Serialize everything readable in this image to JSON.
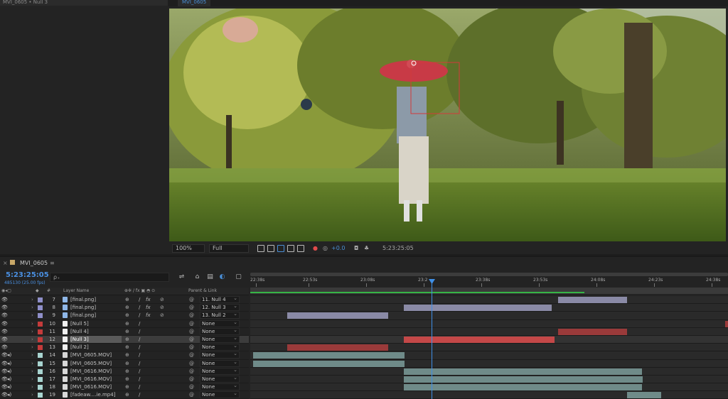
{
  "project_panel": {
    "title": "MVI_0605 • Null 3"
  },
  "viewer": {
    "tab": "MVI_0605",
    "zoom": "100%",
    "resolution": "Full",
    "exposure": "+0.0",
    "timecode": "5:23:25:05"
  },
  "timeline": {
    "comp_tab": "MVI_0605",
    "timecode": "5:23:25:05",
    "frame_info": "485130 (25.00 fps)",
    "search_placeholder": "ρ₊",
    "headers": {
      "layer_name": "Layer Name",
      "parent": "Parent & Link",
      "hash": "#"
    },
    "ruler": [
      "22:38s",
      "22:53s",
      "23:08s",
      "23:2",
      "23:38s",
      "23:53s",
      "24:08s",
      "24:23s",
      "24:38s"
    ],
    "layers": [
      {
        "num": "7",
        "name": "[final.png]",
        "label": "#8f8fc9",
        "kind": "img",
        "audio": false,
        "fx": true,
        "parent": "11. Null 4",
        "bar_color": "#8a8aa6"
      },
      {
        "num": "8",
        "name": "[final.png]",
        "label": "#8f8fc9",
        "kind": "img",
        "audio": false,
        "fx": true,
        "parent": "12. Null 3",
        "bar_color": "#8a8aa6"
      },
      {
        "num": "9",
        "name": "[final.png]",
        "label": "#8f8fc9",
        "kind": "img",
        "audio": false,
        "fx": true,
        "parent": "13. Null 2",
        "bar_color": "#8a8aa6"
      },
      {
        "num": "10",
        "name": "[Null 5]",
        "label": "#c43b3b",
        "kind": "null",
        "audio": false,
        "fx": false,
        "parent": "None",
        "bar_color": "#9a3a3a"
      },
      {
        "num": "11",
        "name": "[Null 4]",
        "label": "#c43b3b",
        "kind": "null",
        "audio": false,
        "fx": false,
        "parent": "None",
        "bar_color": "#9a3a3a"
      },
      {
        "num": "12",
        "name": "[Null 3]",
        "label": "#c43b3b",
        "kind": "null",
        "audio": false,
        "fx": false,
        "parent": "None",
        "bar_color": "#c44848",
        "selected": true
      },
      {
        "num": "13",
        "name": "[Null 2]",
        "label": "#c43b3b",
        "kind": "null",
        "audio": false,
        "fx": false,
        "parent": "None",
        "bar_color": "#9a3a3a"
      },
      {
        "num": "14",
        "name": "[MVI_0605.MOV]",
        "label": "#a8d4d0",
        "kind": "vid",
        "audio": true,
        "fx": false,
        "parent": "None",
        "bar_color": "#6f8b89"
      },
      {
        "num": "15",
        "name": "[MVI_0605.MOV]",
        "label": "#a8d4d0",
        "kind": "vid",
        "audio": true,
        "fx": false,
        "parent": "None",
        "bar_color": "#6f8b89"
      },
      {
        "num": "16",
        "name": "[MVI_0616.MOV]",
        "label": "#a8d4d0",
        "kind": "vid",
        "audio": true,
        "fx": false,
        "parent": "None",
        "bar_color": "#6f8b89"
      },
      {
        "num": "17",
        "name": "[MVI_0616.MOV]",
        "label": "#a8d4d0",
        "kind": "vid",
        "audio": true,
        "fx": false,
        "parent": "None",
        "bar_color": "#6f8b89"
      },
      {
        "num": "18",
        "name": "[MVI_0616.MOV]",
        "label": "#a8d4d0",
        "kind": "vid",
        "audio": true,
        "fx": false,
        "parent": "None",
        "bar_color": "#6f8b89"
      },
      {
        "num": "19",
        "name": "[fadeaw....ie.mp4]",
        "label": "#a8d4d0",
        "kind": "vid",
        "audio": true,
        "fx": false,
        "parent": "None",
        "bar_color": "#6f8b89"
      }
    ]
  }
}
